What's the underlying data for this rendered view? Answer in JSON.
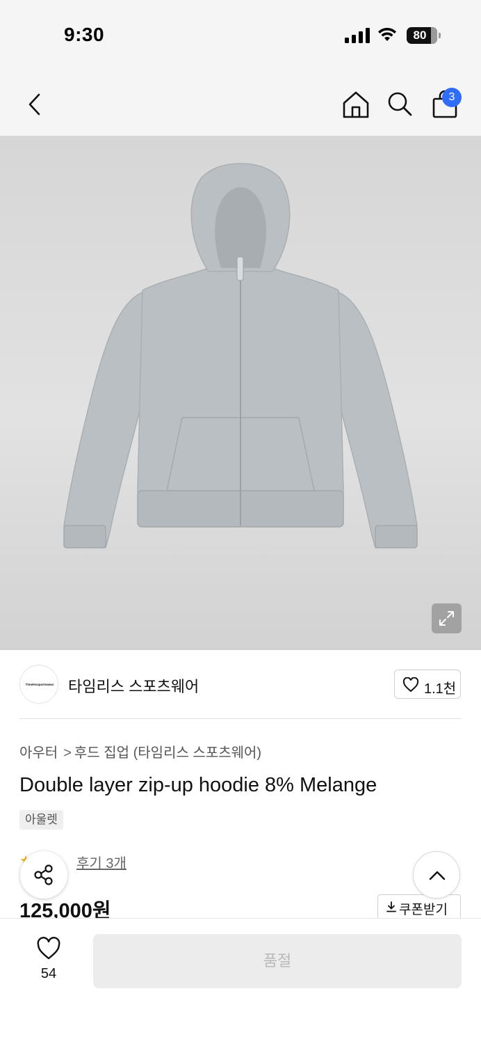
{
  "status_bar": {
    "time": "9:30",
    "battery": "80"
  },
  "nav": {
    "cart_count": "3"
  },
  "brand": {
    "logo_text": "Timelessportswear",
    "name": "타임리스 스포츠웨어",
    "like_count": "1.1천"
  },
  "breadcrumb": {
    "category": "아우터",
    "separator": ">",
    "subcategory": "후드 집업 (타임리스 스포츠웨어)"
  },
  "product": {
    "title": "Double layer zip-up hoodie 8% Melange",
    "tag": "아울렛",
    "rating_icon": "★",
    "review_link": "후기 3개",
    "price": "125,000원"
  },
  "actions": {
    "coupon_label": "쿠폰받기"
  },
  "bottom_bar": {
    "wish_count": "54",
    "buy_button_label": "품절"
  },
  "colors": {
    "accent_badge": "#2f6df6",
    "star": "#f2b01e",
    "hoodie": "#b9bfc2"
  }
}
